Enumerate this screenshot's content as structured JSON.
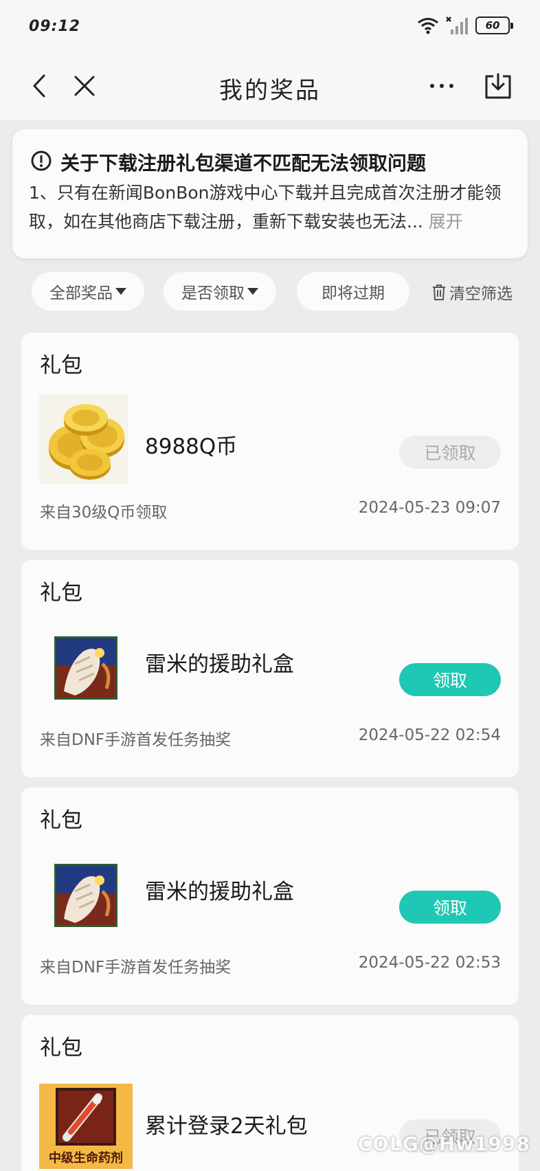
{
  "status": {
    "time": "09:12",
    "battery": "60"
  },
  "nav": {
    "title": "我的奖品"
  },
  "notice": {
    "title": "关于下载注册礼包渠道不匹配无法领取问题",
    "body": "1、只有在新闻BonBon游戏中心下载并且完成首次注册才能领取，如在其他商店下载注册，重新下载安装也无法...",
    "expand": "展开"
  },
  "filters": {
    "all_prizes": "全部奖品",
    "claimed": "是否领取",
    "expiring": "即将过期",
    "clear": "清空筛选"
  },
  "cards": [
    {
      "category": "礼包",
      "name": "8988Q币",
      "source": "来自30级Q币领取",
      "date": "2024-05-23 09:07",
      "button": "已领取",
      "state": "claimed"
    },
    {
      "category": "礼包",
      "name": "雷米的援助礼盒",
      "source": "来自DNF手游首发任务抽奖",
      "date": "2024-05-22 02:54",
      "button": "领取",
      "state": "unclaimed"
    },
    {
      "category": "礼包",
      "name": "雷米的援助礼盒",
      "source": "来自DNF手游首发任务抽奖",
      "date": "2024-05-22 02:53",
      "button": "领取",
      "state": "unclaimed"
    },
    {
      "category": "礼包",
      "name": "累计登录2天礼包",
      "image_label": "中级生命药剂",
      "button": "已领取",
      "state": "claimed"
    }
  ],
  "watermark": "COLG@Hw1998",
  "colors": {
    "accent": "#1ec8b4",
    "background": "#ececec",
    "card": "#fbfbfb"
  }
}
